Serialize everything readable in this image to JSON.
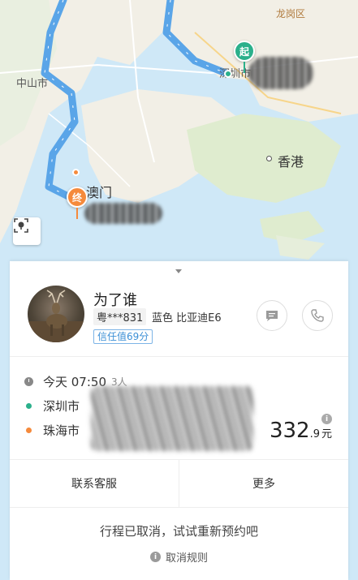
{
  "map": {
    "labels": {
      "longgang": "龙岗区",
      "zhongshan": "中山市",
      "shenzhen": "深圳市",
      "hongkong": "香港",
      "macau": "澳门"
    },
    "start_pin": "起",
    "end_pin": "终",
    "route_color": "#5aa5e8",
    "start_color": "#2bb08b",
    "end_color": "#f58a3c"
  },
  "driver": {
    "name": "为了谁",
    "plate": "粤***831",
    "car": "蓝色 比亚迪E6",
    "trust": "信任值69分"
  },
  "trip": {
    "time": "今天 07:50",
    "people": "3人",
    "from": "深圳市",
    "to": "珠海市",
    "price_int": "332",
    "price_dec": ".9",
    "price_unit": "元"
  },
  "actions": {
    "service": "联系客服",
    "more": "更多"
  },
  "status": {
    "cancelled": "行程已取消，试试重新预约吧",
    "rules": "取消规则"
  },
  "icons": {
    "message": "message-icon",
    "phone": "phone-icon",
    "locate": "locate-icon",
    "info": "info-icon"
  }
}
